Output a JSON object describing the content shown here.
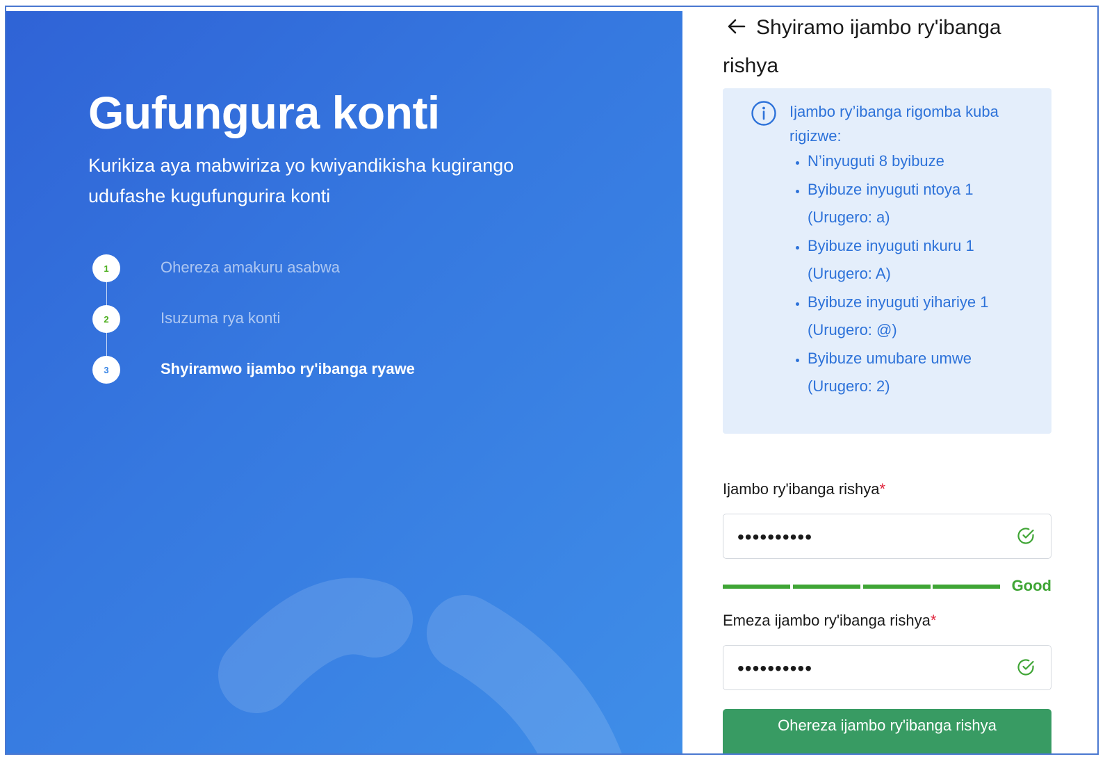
{
  "hero": {
    "title": "Gufungura konti",
    "subtitle": "Kurikiza aya mabwiriza yo kwiyandikisha kugirango udufashe kugufungurira konti",
    "steps": [
      {
        "number": "1",
        "label": "Ohereza amakuru asabwa",
        "state": "done"
      },
      {
        "number": "2",
        "label": "Isuzuma rya konti",
        "state": "done"
      },
      {
        "number": "3",
        "label": "Shyiramwo ijambo ry'ibanga ryawe",
        "state": "active"
      }
    ]
  },
  "form": {
    "back_icon": "arrow-left-icon",
    "title": "Shyiramo ijambo ry'ibanga rishya",
    "rules": {
      "icon": "info-icon",
      "heading": "Ijambo ry’ibanga rigomba kuba rigizwe:",
      "items": [
        "N’inyuguti 8 byibuze",
        "Byibuze inyuguti ntoya 1 (Urugero: a)",
        "Byibuze inyuguti nkuru 1 (Urugero: A)",
        "Byibuze inyuguti yihariye 1 (Urugero: @)",
        "Byibuze umubare umwe (Urugero: 2)"
      ]
    },
    "new_password": {
      "label": "Ijambo ry'ibanga rishya",
      "required_mark": "*",
      "value": "••••••••••",
      "status_icon": "check-circle-icon"
    },
    "strength": {
      "label": "Good",
      "level": 4,
      "max": 4,
      "color": "#3fa535"
    },
    "confirm_password": {
      "label": "Emeza ijambo ry'ibanga rishya",
      "required_mark": "*",
      "value": "••••••••••",
      "status_icon": "check-circle-icon"
    },
    "submit_label": "Ohereza ijambo ry'ibanga rishya"
  },
  "colors": {
    "hero_gradient_start": "#2f63d6",
    "hero_gradient_end": "#3f8ee8",
    "info_text": "#2d72d9",
    "info_bg": "#e4eefb",
    "success": "#3fa535",
    "button": "#389b63",
    "required": "#e0243c"
  }
}
